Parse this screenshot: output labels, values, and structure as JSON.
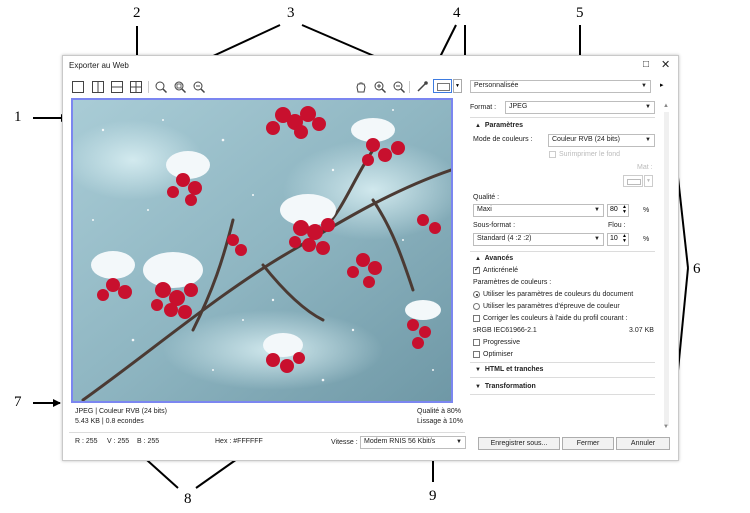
{
  "callouts": [
    "1",
    "2",
    "3",
    "4",
    "5",
    "6",
    "7",
    "8",
    "9"
  ],
  "dialog": {
    "title": "Exporter au Web",
    "maximize_glyph": "□",
    "close_glyph": "✕"
  },
  "toolbar": {
    "icons": [
      "single-view-icon",
      "split-vertical-icon",
      "split-horizontal-icon",
      "quad-view-icon",
      "zoom-icon",
      "zoom-fit-icon",
      "zoom-actual-icon",
      "hand-pan-icon",
      "zoom-in-icon",
      "zoom-out-icon",
      "eyedropper-icon",
      "color-swatch-icon"
    ]
  },
  "preset": {
    "value": "Personnalisée"
  },
  "format": {
    "label": "Format :",
    "value": "JPEG"
  },
  "parametres": {
    "heading": "Paramètres",
    "color_mode_label": "Mode de couleurs :",
    "color_mode_value": "Couleur RVB (24 bits)",
    "transparency_label": "Surimprimer le fond",
    "matte_label": "Mat :",
    "quality_label": "Qualité :",
    "quality_value": "Maxi",
    "quality_number": "80",
    "percent": "%",
    "subformat_label": "Sous-format :",
    "subformat_value": "Standard (4 :2 :2)",
    "blur_label": "Flou :",
    "blur_number": "10"
  },
  "avances": {
    "heading": "Avancés",
    "antialias_label": "Anticrénelé",
    "color_params_label": "Paramètres de couleurs :",
    "radio1": "Utiliser les paramètres de couleurs du document",
    "radio2": "Utiliser les paramètres d'épreuve de couleur",
    "correct_label": "Corriger les couleurs à l'aide du profil courant :",
    "profile": "sRGB IEC61966-2.1",
    "size": "3.07 KB",
    "progressive_label": "Progressive",
    "optimize_label": "Optimiser"
  },
  "sections": {
    "html": "HTML et tranches",
    "transform": "Transformation"
  },
  "preview_info": {
    "line1_left": "JPEG  |  Couleur RVB (24 bits)",
    "line2_left": "5.43 KB  |  0.8 econdes",
    "line1_right": "Qualité à 80%",
    "line2_right": "Lissage à 10%"
  },
  "status": {
    "r": "R : 255",
    "v": "V : 255",
    "b": "B : 255",
    "hex": "Hex : #FFFFFF",
    "speed_label": "Vitesse :",
    "speed_value": "Modem RNIS 56 Kbit/s"
  },
  "buttons": {
    "save": "Enregistrer sous...",
    "close": "Fermer",
    "cancel": "Annuler"
  },
  "colors": {
    "preview_border": "#7b86f0",
    "berry": "#c8102e",
    "sky": "#8fb6c2"
  }
}
